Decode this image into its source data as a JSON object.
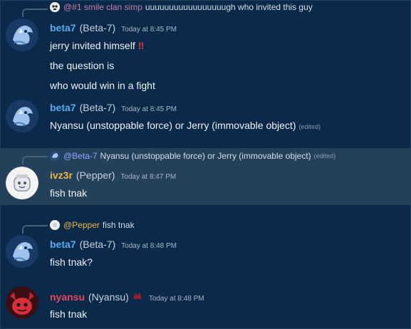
{
  "messages": [
    {
      "reply": {
        "mention": "@#1 smile clan simp",
        "text": "uuuuuuuuuuuuuuuuugh who invited this guy"
      },
      "author": "beta7",
      "nick": "(Beta-7)",
      "time": "Today at 8:45 PM",
      "lines": [
        "jerry invited himself",
        "the question is",
        "who would win in a fight"
      ],
      "emoji": "!!"
    },
    {
      "author": "beta7",
      "nick": "(Beta-7)",
      "time": "Today at 8:45 PM",
      "lines": [
        "Nyansu (unstoppable force) or Jerry (immovable object)"
      ],
      "edited": "(edited)"
    },
    {
      "reply": {
        "mention": "@Beta-7",
        "text": "Nyansu (unstoppable force) or Jerry (immovable object)",
        "edited": "(edited)"
      },
      "author": "ivz3r",
      "nick": "(Pepper)",
      "time": "Today at 8:47 PM",
      "lines": [
        "fish tnak"
      ]
    },
    {
      "reply": {
        "mention": "@Pepper",
        "text": "fish tnak"
      },
      "author": "beta7",
      "nick": "(Beta-7)",
      "time": "Today at 8:48 PM",
      "lines": [
        "fish tnak?"
      ]
    },
    {
      "author": "nyansu",
      "nick": "(Nyansu)",
      "time": "Today at 8:48 PM",
      "lines": [
        "fish tnak"
      ]
    }
  ],
  "colors": {
    "background": "#0b2a4a",
    "highlight": "#24415c",
    "beta7": "#5aa9f0",
    "ivz3r": "#f0b445",
    "nyansu": "#e3485a",
    "mention": "#8ea9ff"
  },
  "icons": [
    "dragon-avatar-icon",
    "jar-avatar-icon",
    "demon-avatar-icon",
    "skull-reply-icon",
    "badge-icon"
  ]
}
